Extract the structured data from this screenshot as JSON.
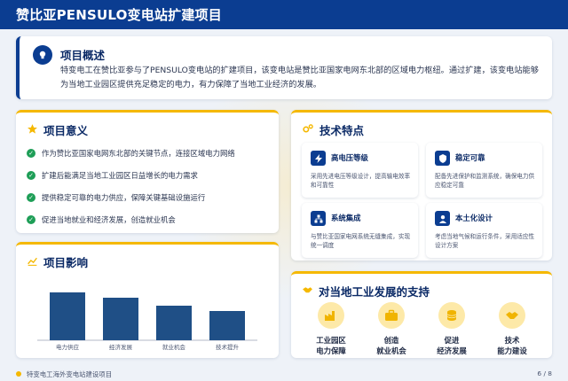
{
  "header": {
    "title": "赞比亚PENSULO变电站扩建项目"
  },
  "overview": {
    "title": "项目概述",
    "text": "特变电工在赞比亚参与了PENSULO变电站的扩建项目，该变电站是赞比亚国家电网东北部的区域电力枢纽。通过扩建，该变电站能够为当地工业园区提供充足稳定的电力，有力保障了当地工业经济的发展。",
    "icon": "lightbulb-icon"
  },
  "significance": {
    "title": "项目意义",
    "icon": "star-icon",
    "items": [
      "作为赞比亚国家电网东北部的关键节点，连接区域电力网络",
      "扩建后能满足当地工业园区日益增长的电力需求",
      "提供稳定可靠的电力供应，保障关键基础设施运行",
      "促进当地就业和经济发展，创造就业机会"
    ]
  },
  "impact": {
    "title": "项目影响",
    "icon": "line-chart-icon"
  },
  "chart_data": {
    "type": "bar",
    "categories": [
      "电力供应",
      "经济发展",
      "就业机会",
      "技术提升"
    ],
    "values": [
      90,
      80,
      65,
      55
    ],
    "ylim": [
      0,
      100
    ],
    "title": "项目影响",
    "xlabel": "",
    "ylabel": "",
    "grid": false,
    "bar_color": "#1f4f86"
  },
  "tech": {
    "title": "技术特点",
    "icon": "gears-icon",
    "tiles": [
      {
        "title": "高电压等级",
        "desc": "采用先进电压等级设计，提高输电效率和可靠性",
        "icon": "bolt-icon"
      },
      {
        "title": "稳定可靠",
        "desc": "配备先进保护和监测系统，确保电力供应稳定可靠",
        "icon": "shield-icon"
      },
      {
        "title": "系统集成",
        "desc": "与赞比亚国家电网系统无缝集成，实现统一调度",
        "icon": "network-icon"
      },
      {
        "title": "本土化设计",
        "desc": "考虑当地气候和运行条件，采用适应性设计方案",
        "icon": "worker-icon"
      }
    ]
  },
  "support": {
    "title": "对当地工业发展的支持",
    "icon": "handshake-icon",
    "items": [
      {
        "line1": "工业园区",
        "line2": "电力保障",
        "icon": "factory-icon"
      },
      {
        "line1": "创造",
        "line2": "就业机会",
        "icon": "briefcase-icon"
      },
      {
        "line1": "促进",
        "line2": "经济发展",
        "icon": "coins-icon"
      },
      {
        "line1": "技术",
        "line2": "能力建设",
        "icon": "handshake-icon"
      }
    ]
  },
  "footer": {
    "text": "特变电工海外变电站建设项目",
    "page": "6 / 8"
  },
  "colors": {
    "primary": "#0b3d91",
    "accent": "#f5b800",
    "check": "#1e9e57",
    "support_bg": "#fde9a8"
  }
}
